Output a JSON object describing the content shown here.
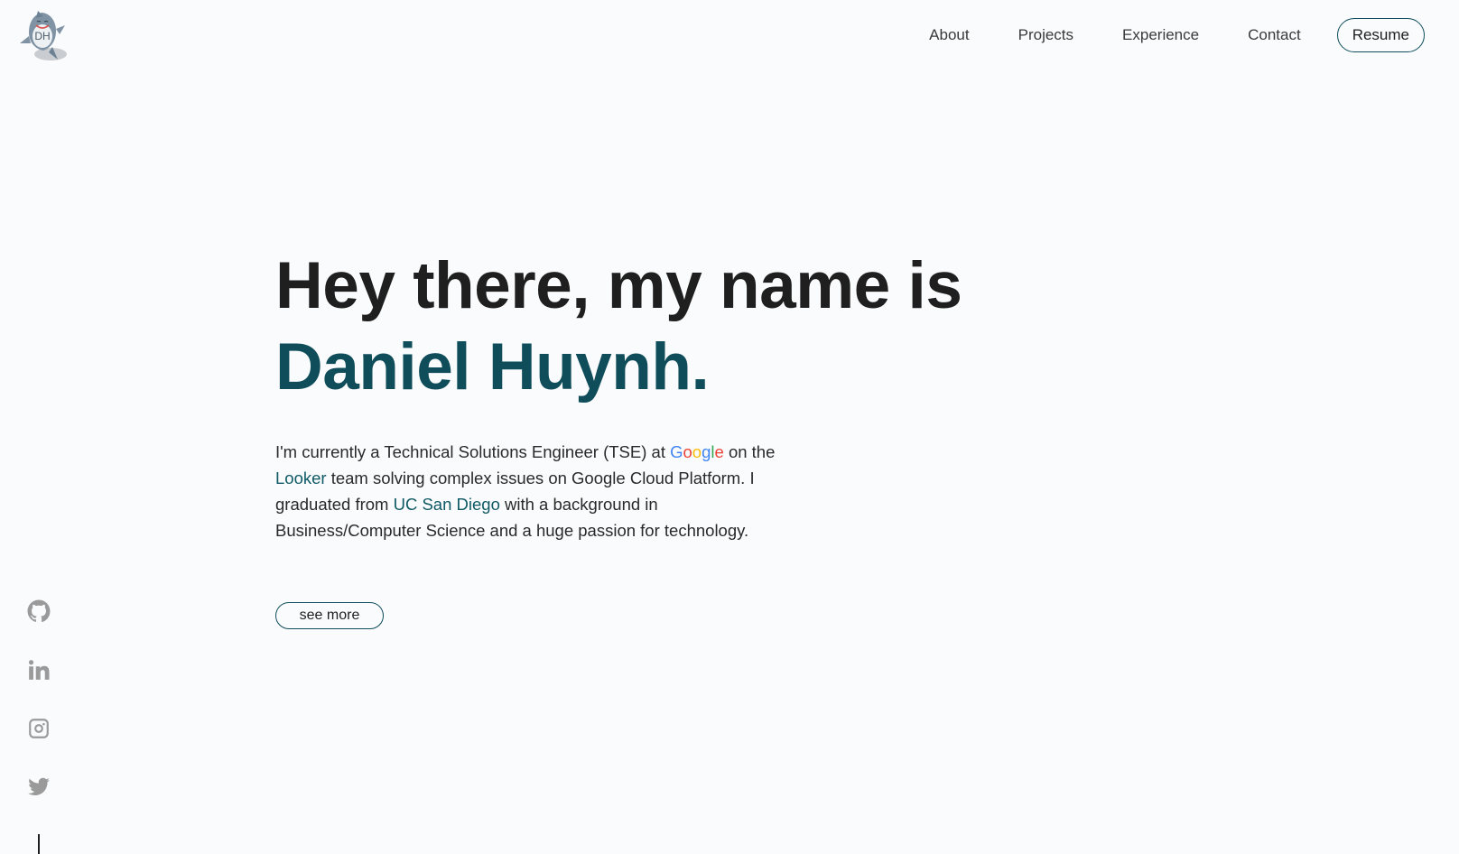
{
  "logo": {
    "text": "DH",
    "icon": "shark-icon"
  },
  "nav": {
    "items": [
      {
        "label": "About"
      },
      {
        "label": "Projects"
      },
      {
        "label": "Experience"
      },
      {
        "label": "Contact"
      }
    ],
    "resume_label": "Resume"
  },
  "hero": {
    "greeting": "Hey there, my name is",
    "name": "Daniel Huynh.",
    "bio": {
      "part1": "I'm currently a Technical Solutions Engineer (TSE) at ",
      "google_letters": [
        "G",
        "o",
        "o",
        "g",
        "l",
        "e"
      ],
      "part2": " on the ",
      "looker": "Looker",
      "part3": " team solving complex issues on Google Cloud Platform. I graduated from ",
      "ucsd": "UC San Diego",
      "part4": " with a background in Business/Computer Science and a huge passion for technology."
    },
    "see_more_label": "see more"
  },
  "social": [
    {
      "icon": "github-icon"
    },
    {
      "icon": "linkedin-icon"
    },
    {
      "icon": "instagram-icon"
    },
    {
      "icon": "twitter-icon"
    }
  ],
  "colors": {
    "accent": "#0f4d5a",
    "background": "#fafbfc",
    "text": "#1f1f1f",
    "icon_gray": "#9a9a9a",
    "google_blue": "#4285F4",
    "google_red": "#EA4335",
    "google_yellow": "#FBBC05",
    "google_green": "#34A853"
  }
}
